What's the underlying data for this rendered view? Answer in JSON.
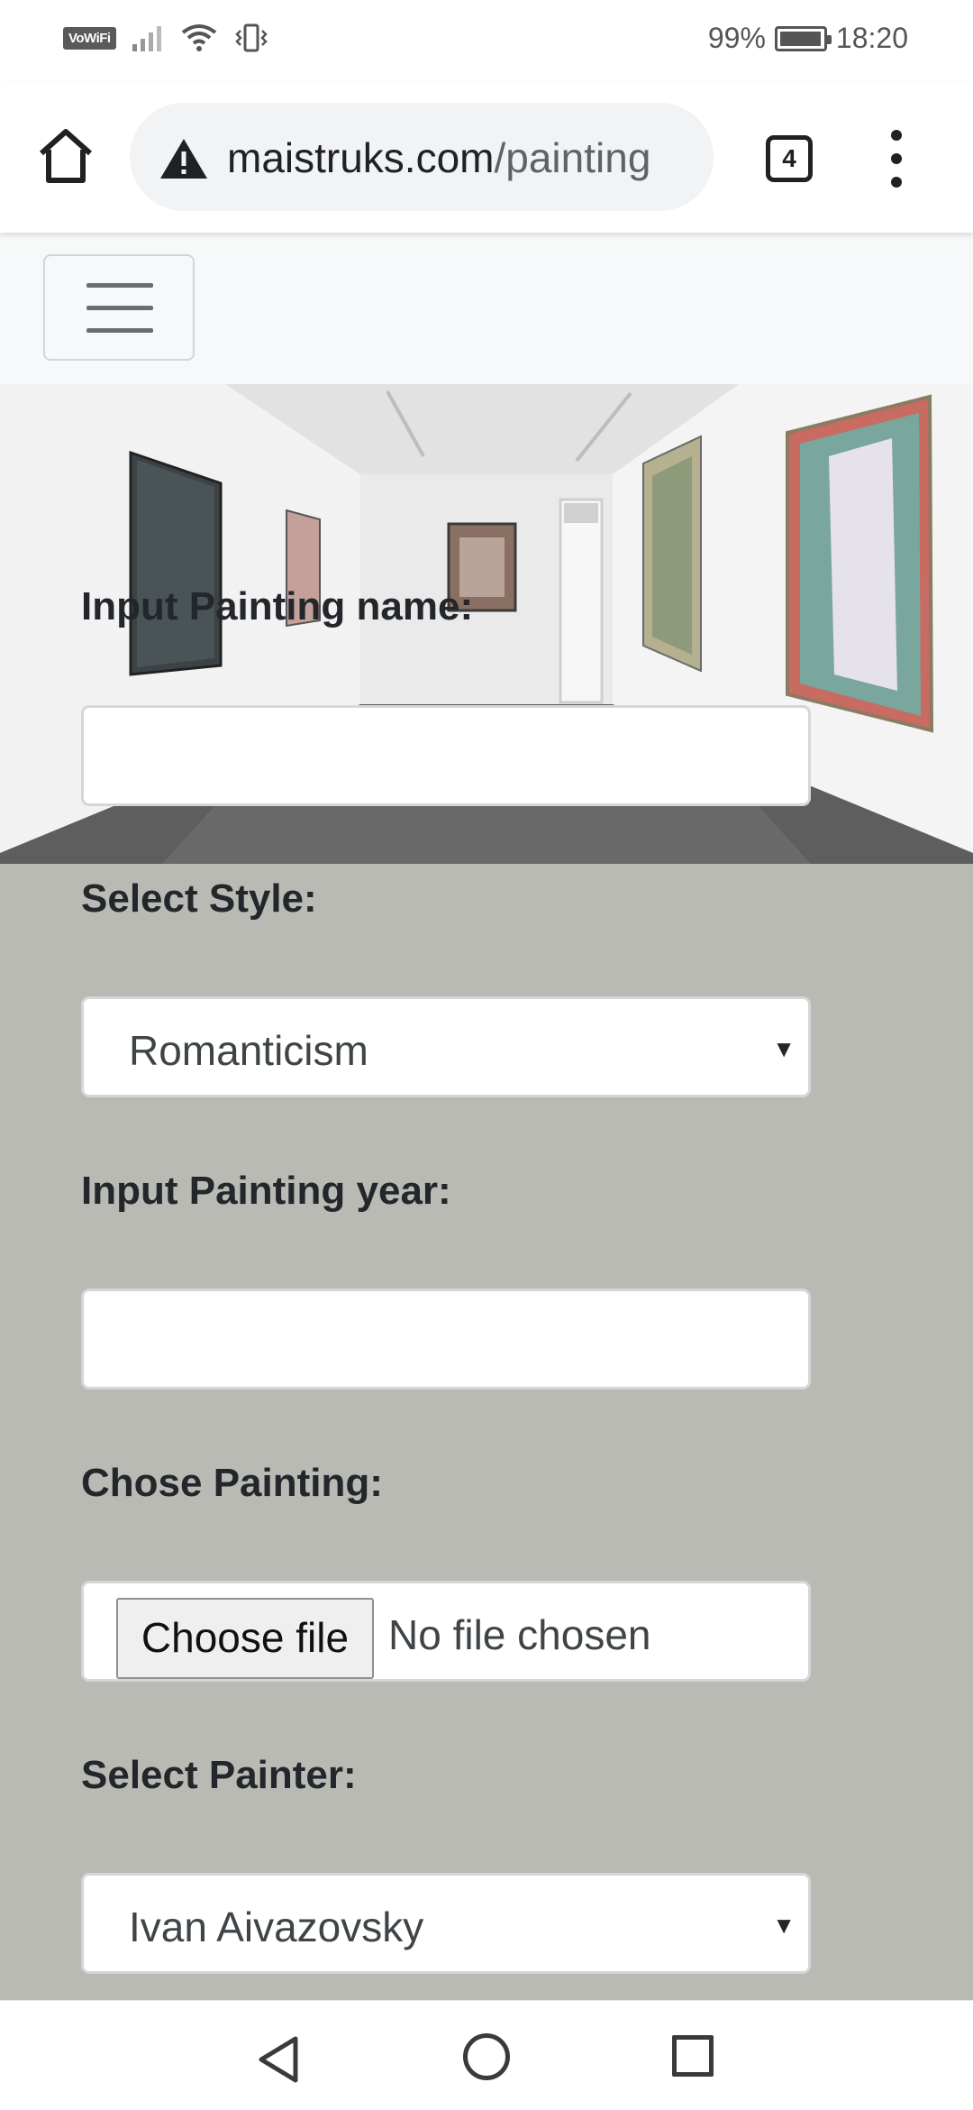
{
  "status_bar": {
    "network_badge": "VoWiFi",
    "battery_percent": "99%",
    "battery_level": 0.99,
    "time": "18:20",
    "icons": [
      "signal-icon",
      "wifi-icon",
      "vibrate-icon",
      "battery-icon"
    ]
  },
  "browser": {
    "url_domain": "maistruks.com",
    "url_path": "/painting",
    "tab_count": "4",
    "icons": [
      "home-icon",
      "warning-icon",
      "tabs-icon",
      "more-menu-icon"
    ]
  },
  "navbar": {
    "toggle_icon": "hamburger-icon"
  },
  "form": {
    "name_label": "Input Painting name:",
    "name_value": "",
    "style_label": "Select Style:",
    "style_selected": "Romanticism",
    "year_label": "Input Painting year:",
    "year_value": "",
    "file_label": "Chose Painting:",
    "file_button": "Choose file",
    "file_status": "No file chosen",
    "painter_label": "Select Painter:",
    "painter_selected": "Ivan Aivazovsky",
    "caret_glyph": "▼"
  },
  "system_nav": {
    "icons": [
      "back-icon",
      "home-circle-icon",
      "recents-icon"
    ]
  },
  "colors": {
    "page_background": "#b8bab3",
    "navbar_background": "#f7f8f9",
    "label_text": "#23272b"
  }
}
